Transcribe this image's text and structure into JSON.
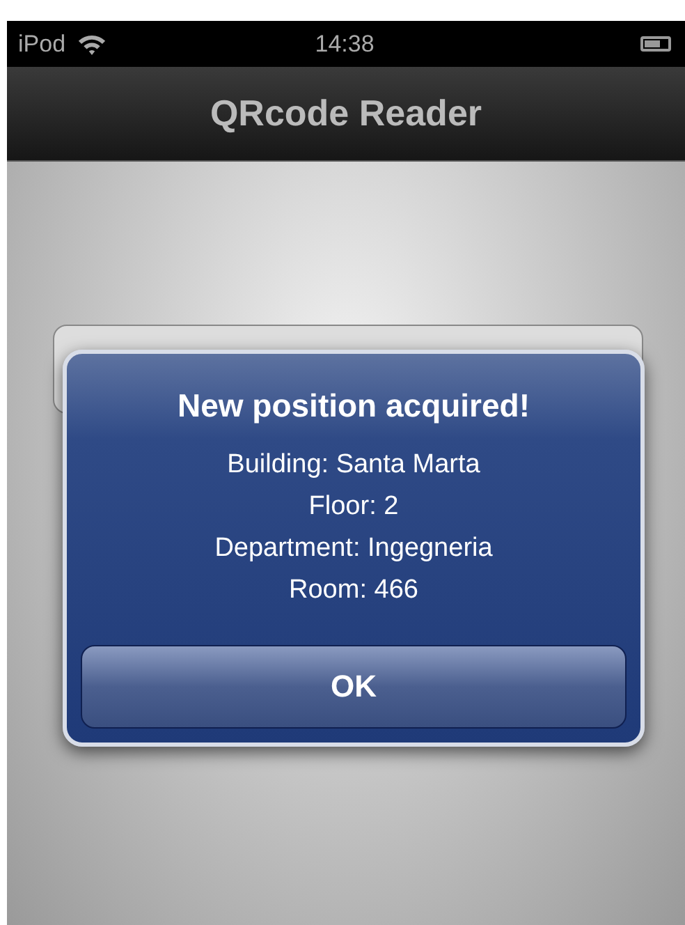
{
  "status_bar": {
    "carrier": "iPod",
    "time": "14:38"
  },
  "nav_bar": {
    "title": "QRcode Reader"
  },
  "alert": {
    "title": "New position acquired!",
    "lines": [
      "Building: Santa Marta",
      "Floor: 2",
      "Department: Ingegneria",
      "Room: 466"
    ],
    "buttons": [
      "OK"
    ]
  }
}
